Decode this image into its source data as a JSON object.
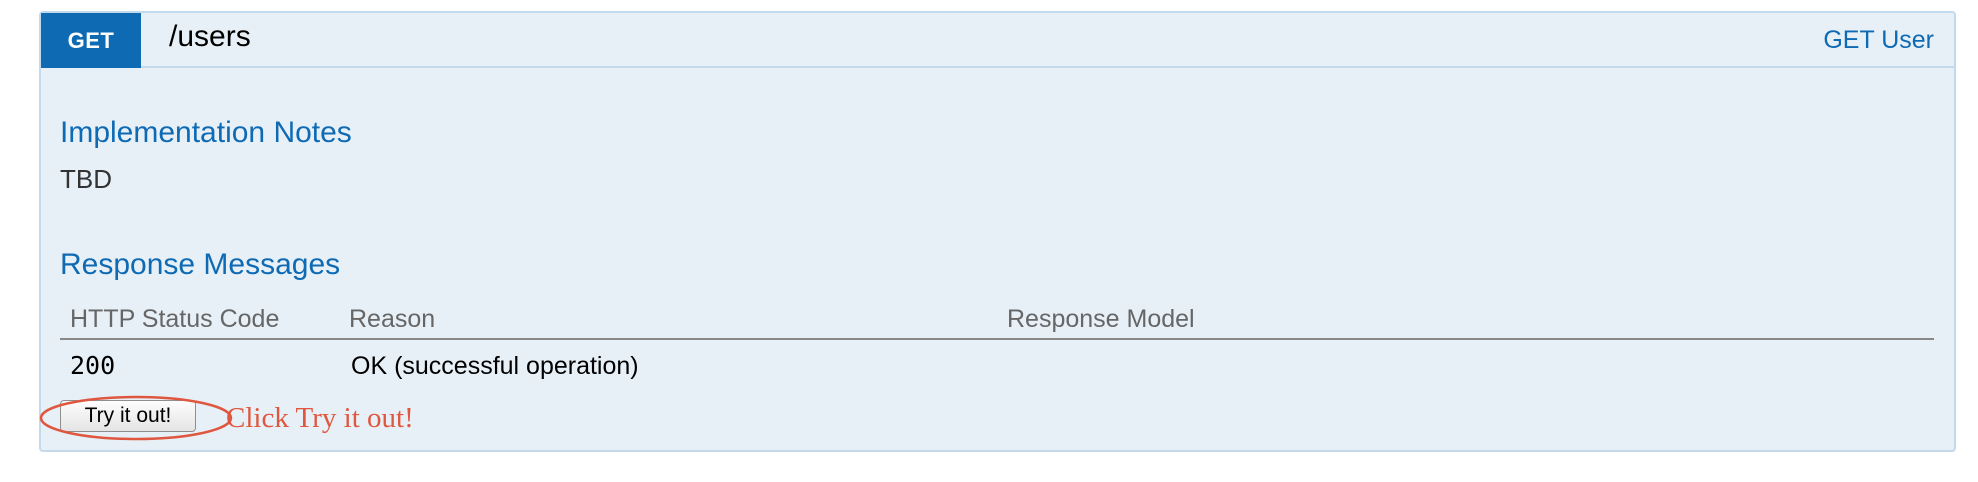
{
  "operation": {
    "method": "GET",
    "path": "/users",
    "summary": "GET User"
  },
  "implementation_notes": {
    "heading": "Implementation Notes",
    "text": "TBD"
  },
  "response_messages": {
    "heading": "Response Messages",
    "columns": [
      "HTTP Status Code",
      "Reason",
      "Response Model"
    ],
    "rows": [
      {
        "code": "200",
        "reason": "OK (successful operation)",
        "model": ""
      }
    ]
  },
  "try_button": {
    "label": "Try it out!"
  },
  "annotation": {
    "text": "Click Try it out!",
    "color": "#e0573f"
  },
  "colors": {
    "method_badge": "#0f6ab4",
    "panel_background": "#e7f0f7",
    "panel_border": "#c3d9ec",
    "heading": "#0f6ab4"
  }
}
